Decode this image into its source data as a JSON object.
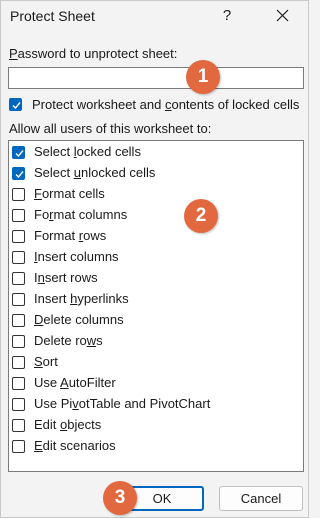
{
  "window": {
    "title": "Protect Sheet",
    "help_glyph": "?",
    "close_icon": "close-icon"
  },
  "password": {
    "label_prefix": "",
    "label_mnemonic": "P",
    "label_rest": "assword to unprotect sheet:",
    "value": "",
    "placeholder": ""
  },
  "protect_option": {
    "label_a": "Protect worksheet and ",
    "label_mnemonic": "c",
    "label_b": "ontents of locked cells",
    "checked": true
  },
  "permissions": {
    "heading_a": "Allow all users of this worksheet to:",
    "items": [
      {
        "a": "Select ",
        "m": "l",
        "b": "ocked cells",
        "checked": true
      },
      {
        "a": "Select ",
        "m": "u",
        "b": "nlocked cells",
        "checked": true
      },
      {
        "a": "",
        "m": "F",
        "b": "ormat cells",
        "checked": false
      },
      {
        "a": "Fo",
        "m": "r",
        "b": "mat columns",
        "checked": false
      },
      {
        "a": "Format ",
        "m": "r",
        "b": "ows",
        "checked": false
      },
      {
        "a": "",
        "m": "I",
        "b": "nsert columns",
        "checked": false
      },
      {
        "a": "I",
        "m": "n",
        "b": "sert rows",
        "checked": false
      },
      {
        "a": "Insert ",
        "m": "h",
        "b": "yperlinks",
        "checked": false
      },
      {
        "a": "",
        "m": "D",
        "b": "elete columns",
        "checked": false
      },
      {
        "a": "Delete ro",
        "m": "w",
        "b": "s",
        "checked": false
      },
      {
        "a": "",
        "m": "S",
        "b": "ort",
        "checked": false
      },
      {
        "a": "Use ",
        "m": "A",
        "b": "utoFilter",
        "checked": false
      },
      {
        "a": "Use Pi",
        "m": "v",
        "b": "otTable and PivotChart",
        "checked": false
      },
      {
        "a": "Edit ",
        "m": "o",
        "b": "bjects",
        "checked": false
      },
      {
        "a": "",
        "m": "E",
        "b": "dit scenarios",
        "checked": false
      }
    ]
  },
  "buttons": {
    "ok": "OK",
    "cancel": "Cancel"
  },
  "callouts": [
    "1",
    "2",
    "3"
  ],
  "colors": {
    "accent": "#0067c0",
    "callout": "#e1683f",
    "background": "#f3f3f3"
  }
}
